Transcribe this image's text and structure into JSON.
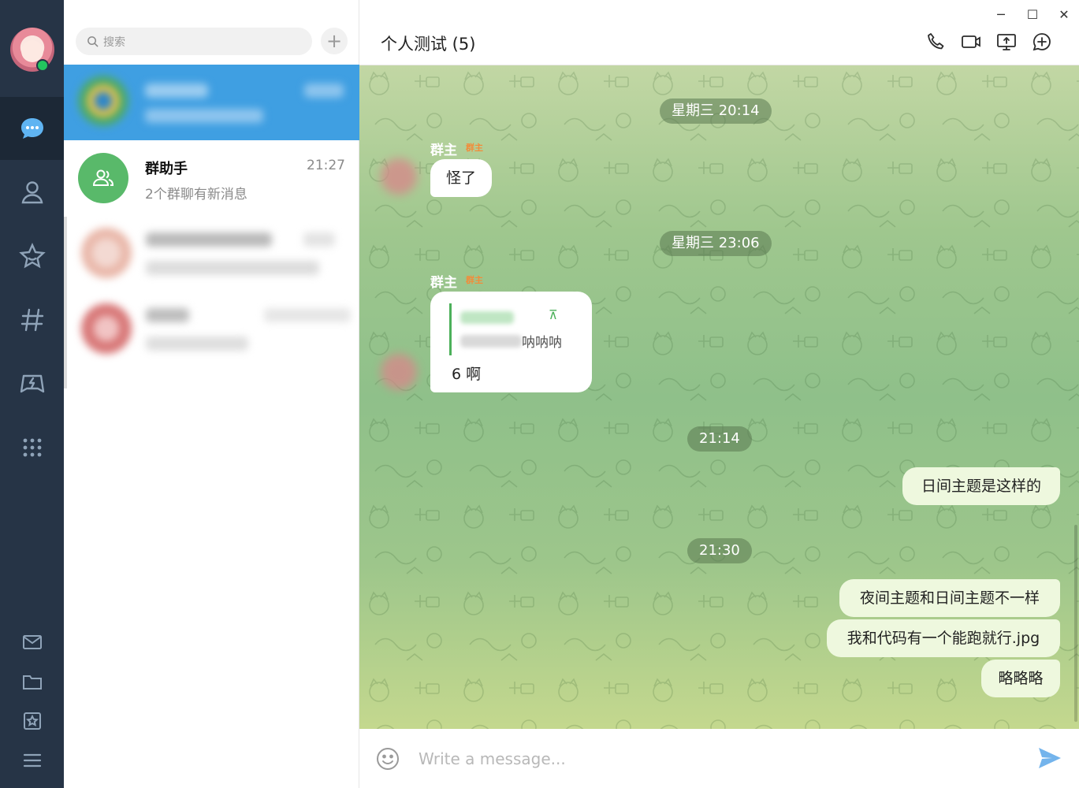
{
  "search": {
    "placeholder": "搜索"
  },
  "chats": [
    {
      "name": "群助手",
      "time": "21:27",
      "preview": "2个群聊有新消息"
    }
  ],
  "chat": {
    "title": "个人测试 (5)",
    "composer_placeholder": "Write a message...",
    "messages": {
      "date1": "星期三 20:14",
      "sender1": "群主",
      "role1": "群主",
      "text1": "怪了",
      "date2": "星期三 23:06",
      "sender2": "群主",
      "role2": "群主",
      "reply_quote_tail": "呐呐呐",
      "reply_text": "6 啊",
      "time3": "21:14",
      "out1": "日间主题是这样的",
      "time4": "21:30",
      "out2": "夜间主题和日间主题不一样",
      "out3": "我和代码有一个能跑就行.jpg",
      "out4": "略略略"
    }
  },
  "colors": {
    "rail": "#263446",
    "selected": "#3f9fe2",
    "accent_green": "#59b96a",
    "outgoing_bubble": "#eef8de"
  },
  "icons": [
    "chat-icon",
    "contacts-icon",
    "star-icon",
    "hashtag-icon",
    "game-icon",
    "apps-icon",
    "mail-icon",
    "folder-icon",
    "bookmark-icon",
    "menu-icon",
    "phone-icon",
    "video-icon",
    "screen-share-icon",
    "add-member-icon",
    "emoji-icon",
    "send-icon"
  ]
}
